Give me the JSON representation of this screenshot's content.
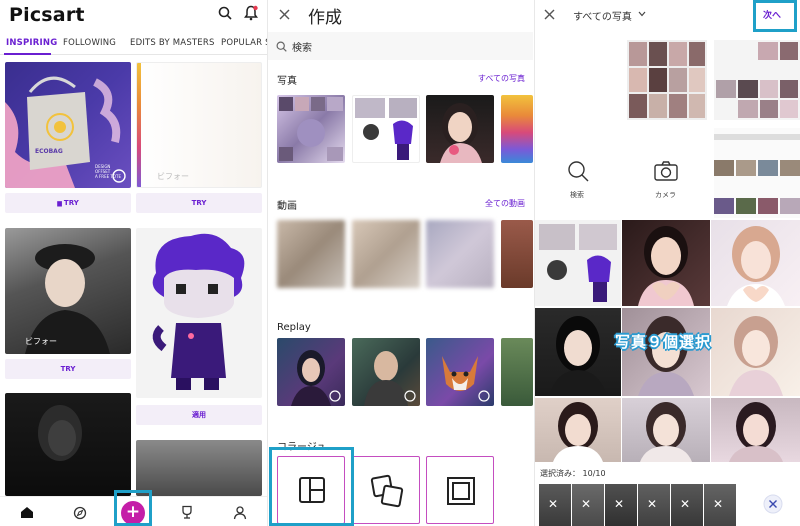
{
  "panel1": {
    "app_name": "Picsart",
    "tabs": [
      "INSPIRING",
      "FOLLOWING",
      "EDITS BY MASTERS",
      "POPULAR S"
    ],
    "cards": {
      "tote_text": "ECOBAG",
      "tote_caption": "DESIGN\nOFFSET\nA FREE TOTE",
      "before_label_right": "ビフォー",
      "before_label_left": "ビフォー"
    },
    "buttons": {
      "try_1": "TRY",
      "try_2": "TRY",
      "try_3": "TRY",
      "apply": "適用"
    },
    "nav": [
      "home-icon",
      "compass-icon",
      "plus-icon",
      "trophy-icon",
      "user-icon"
    ],
    "plus_symbol": "+"
  },
  "panel2": {
    "title": "作成",
    "search_placeholder": "検索",
    "sections": {
      "photos": {
        "title": "写真",
        "link": "すべての写真"
      },
      "videos": {
        "title": "動画",
        "link": "全ての動画"
      },
      "replay": {
        "title": "Replay"
      },
      "collage": {
        "title": "コラージュ"
      }
    }
  },
  "panel3": {
    "title": "すべての写真",
    "next": "次へ",
    "search_label": "検索",
    "camera_label": "カメラ",
    "overlay": "写真９個選択",
    "selected_label": "選択済み：",
    "selected_count": "10/10"
  },
  "colors": {
    "accent": "#6a1fd1",
    "highlight": "#1fa0c8",
    "plus": "#c41ea8",
    "collage_border": "#c44dc0"
  }
}
